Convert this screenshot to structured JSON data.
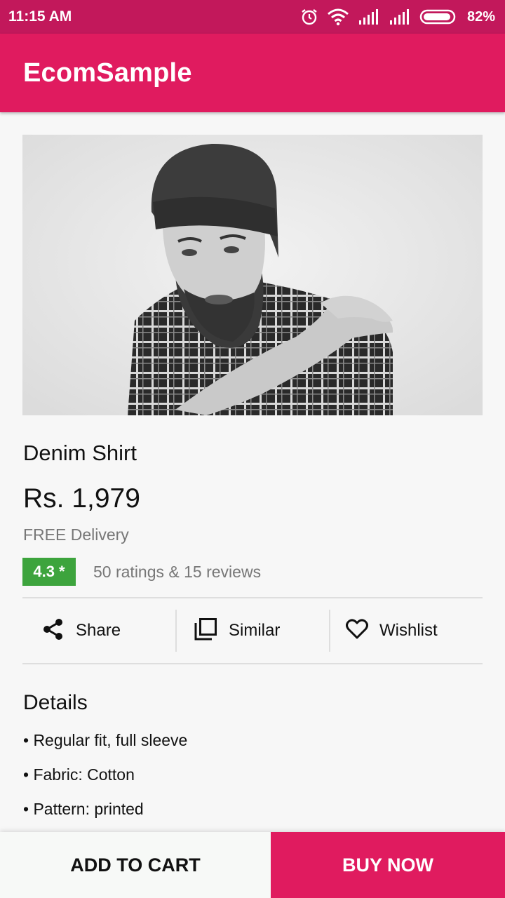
{
  "status_bar": {
    "time": "11:15 AM",
    "battery_percent": "82%",
    "color": "#c2185b"
  },
  "app_bar": {
    "title": "EcomSample",
    "color": "#e01b5f"
  },
  "product": {
    "image_icon": "product-photo-bearded-man-beanie",
    "name": "Denim Shirt",
    "price": "Rs. 1,979",
    "delivery": "FREE Delivery",
    "rating": "4.3 *",
    "rating_color": "#3da43d",
    "ratings_text": "50 ratings & 15 reviews"
  },
  "actions": [
    {
      "label": "Share",
      "icon": "share-icon"
    },
    {
      "label": "Similar",
      "icon": "similar-icon"
    },
    {
      "label": "Wishlist",
      "icon": "heart-icon"
    }
  ],
  "details": {
    "title": "Details",
    "items": [
      "• Regular fit, full sleeve",
      "• Fabric: Cotton",
      "• Pattern: printed"
    ]
  },
  "bottom_bar": {
    "add_to_cart": "ADD TO CART",
    "buy_now": "BUY NOW"
  }
}
